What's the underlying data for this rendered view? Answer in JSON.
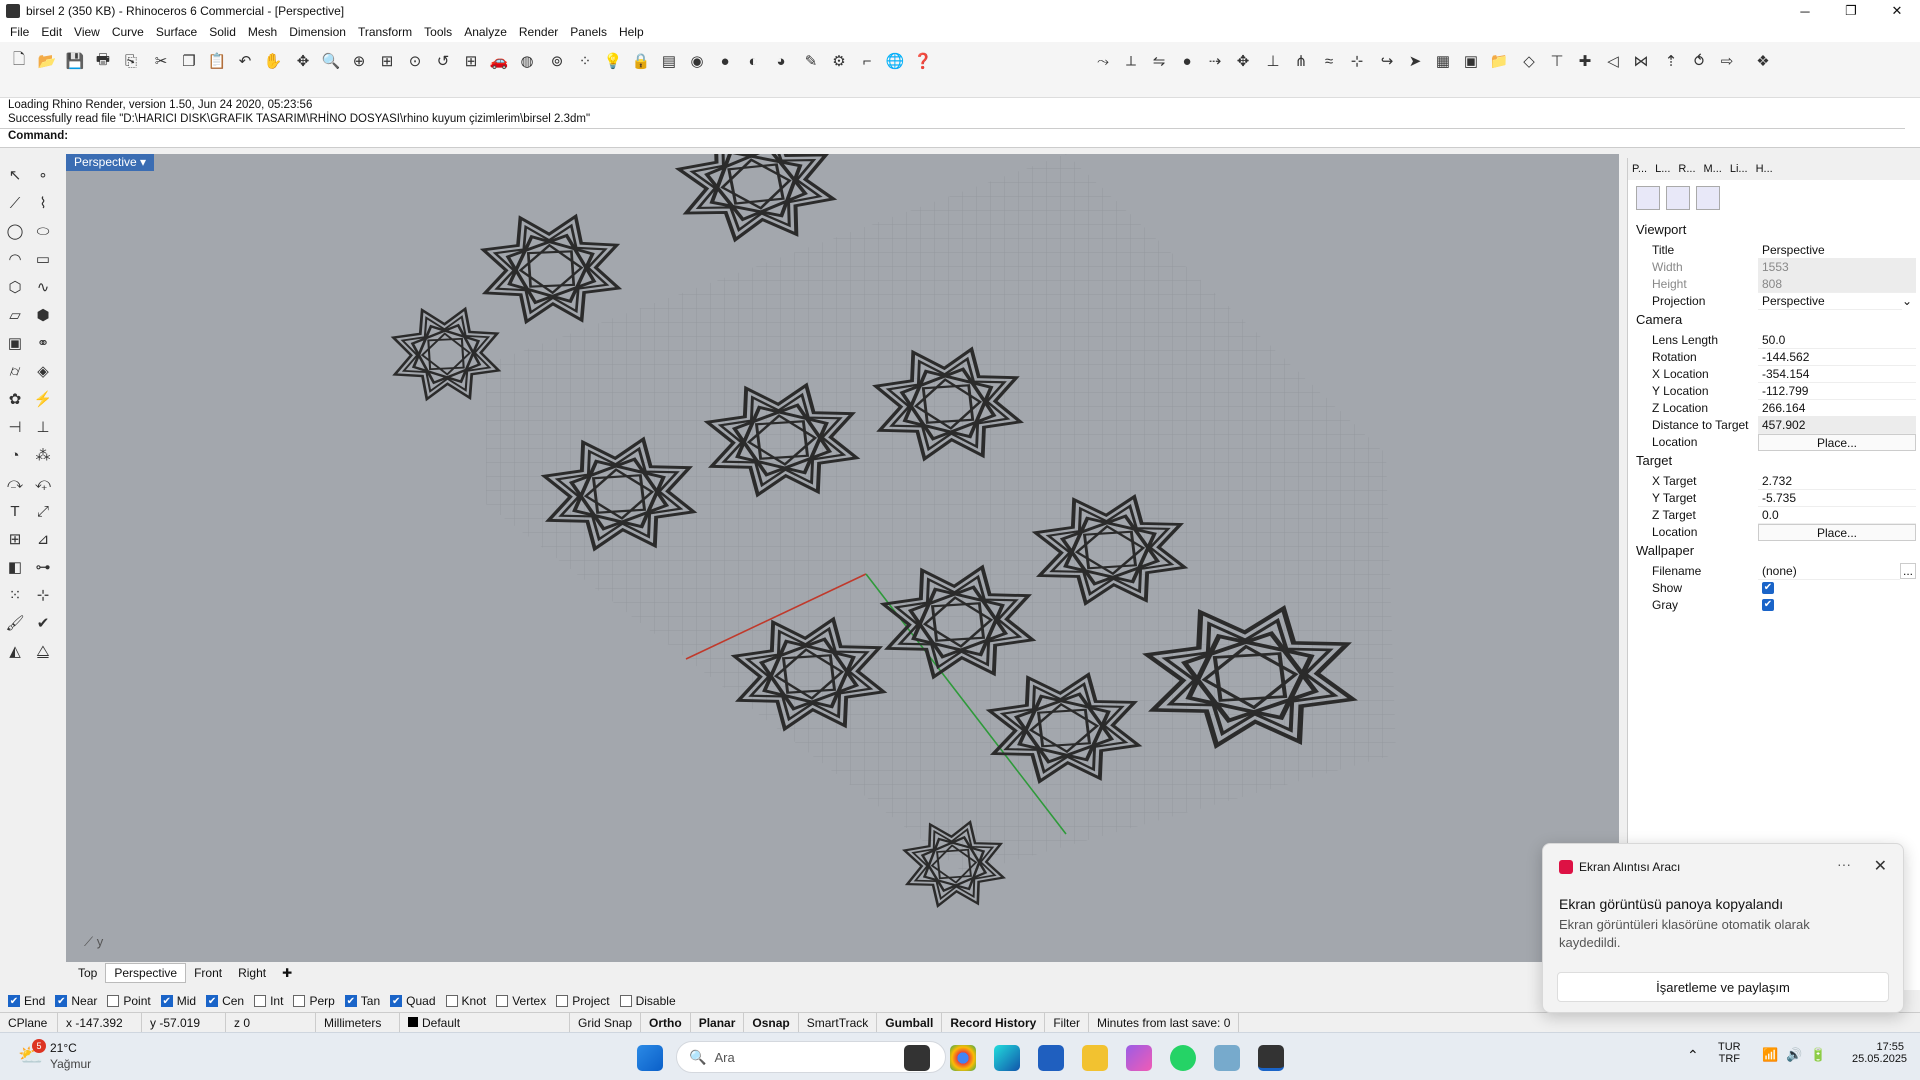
{
  "window": {
    "title": "birsel 2 (350 KB) - Rhinoceros 6 Commercial - [Perspective]",
    "minimize": "─",
    "maximize": "❐",
    "close": "✕"
  },
  "menu": [
    "File",
    "Edit",
    "View",
    "Curve",
    "Surface",
    "Solid",
    "Mesh",
    "Dimension",
    "Transform",
    "Tools",
    "Analyze",
    "Render",
    "Panels",
    "Help"
  ],
  "command_history": [
    "Loading Rhino Render, version 1.50, Jun 24 2020, 05:23:56",
    "Successfully read file \"D:\\HARICI DISK\\GRAFIK TASARIM\\RHİNO DOSYASI\\rhino kuyum çizimlerim\\birsel 2.3dm\""
  ],
  "command_prompt": "Command:",
  "viewport": {
    "title": "Perspective",
    "axis_label": "y",
    "bg": "#a3a7ad"
  },
  "view_tabs": [
    "Top",
    "Perspective",
    "Front",
    "Right"
  ],
  "active_view_tab": "Perspective",
  "osnaps": [
    {
      "label": "End",
      "on": true
    },
    {
      "label": "Near",
      "on": true
    },
    {
      "label": "Point",
      "on": false
    },
    {
      "label": "Mid",
      "on": true
    },
    {
      "label": "Cen",
      "on": true
    },
    {
      "label": "Int",
      "on": false
    },
    {
      "label": "Perp",
      "on": false
    },
    {
      "label": "Tan",
      "on": true
    },
    {
      "label": "Quad",
      "on": true
    },
    {
      "label": "Knot",
      "on": false
    },
    {
      "label": "Vertex",
      "on": false
    },
    {
      "label": "Project",
      "on": false
    },
    {
      "label": "Disable",
      "on": false
    }
  ],
  "status": {
    "cplane": "CPlane",
    "x": "x -147.392",
    "y": "y -57.019",
    "z": "z 0",
    "units": "Millimeters",
    "layer": "Default",
    "grid_snap": "Grid Snap",
    "ortho": "Ortho",
    "planar": "Planar",
    "osnap": "Osnap",
    "smarttrack": "SmartTrack",
    "gumball": "Gumball",
    "record_history": "Record History",
    "filter": "Filter",
    "last_save": "Minutes from last save: 0"
  },
  "panel": {
    "tabs": [
      "P...",
      "L...",
      "R...",
      "M...",
      "Li...",
      "H..."
    ],
    "sections": {
      "viewport": "Viewport",
      "camera": "Camera",
      "target": "Target",
      "wallpaper": "Wallpaper"
    },
    "viewport_rows": [
      {
        "k": "Title",
        "v": "Perspective"
      },
      {
        "k": "Width",
        "v": "1553"
      },
      {
        "k": "Height",
        "v": "808"
      },
      {
        "k": "Projection",
        "v": "Perspective"
      }
    ],
    "camera_rows": [
      {
        "k": "Lens Length",
        "v": "50.0"
      },
      {
        "k": "Rotation",
        "v": "-144.562"
      },
      {
        "k": "X Location",
        "v": "-354.154"
      },
      {
        "k": "Y Location",
        "v": "-112.799"
      },
      {
        "k": "Z Location",
        "v": "266.164"
      },
      {
        "k": "Distance to Target",
        "v": "457.902"
      },
      {
        "k": "Location",
        "v": "Place..."
      }
    ],
    "target_rows": [
      {
        "k": "X Target",
        "v": "2.732"
      },
      {
        "k": "Y Target",
        "v": "-5.735"
      },
      {
        "k": "Z Target",
        "v": "0.0"
      },
      {
        "k": "Location",
        "v": "Place..."
      }
    ],
    "wallpaper_rows": [
      {
        "k": "Filename",
        "v": "(none)"
      },
      {
        "k": "Show",
        "v": ""
      },
      {
        "k": "Gray",
        "v": ""
      }
    ],
    "ellipsis": "..."
  },
  "toast": {
    "app": "Ekran Alıntısı Aracı",
    "title": "Ekran görüntüsü panoya kopyalandı",
    "body": "Ekran görüntüleri klasörüne otomatik olarak kaydedildi.",
    "action": "İşaretleme ve paylaşım",
    "dots": "···",
    "close": "✕"
  },
  "taskbar": {
    "weather_temp": "21°C",
    "weather_desc": "Yağmur",
    "weather_badge": "5",
    "search_placeholder": "Ara",
    "lang_top": "TUR",
    "lang_bottom": "TRF",
    "time": "17:55",
    "date": "25.05.2025"
  }
}
